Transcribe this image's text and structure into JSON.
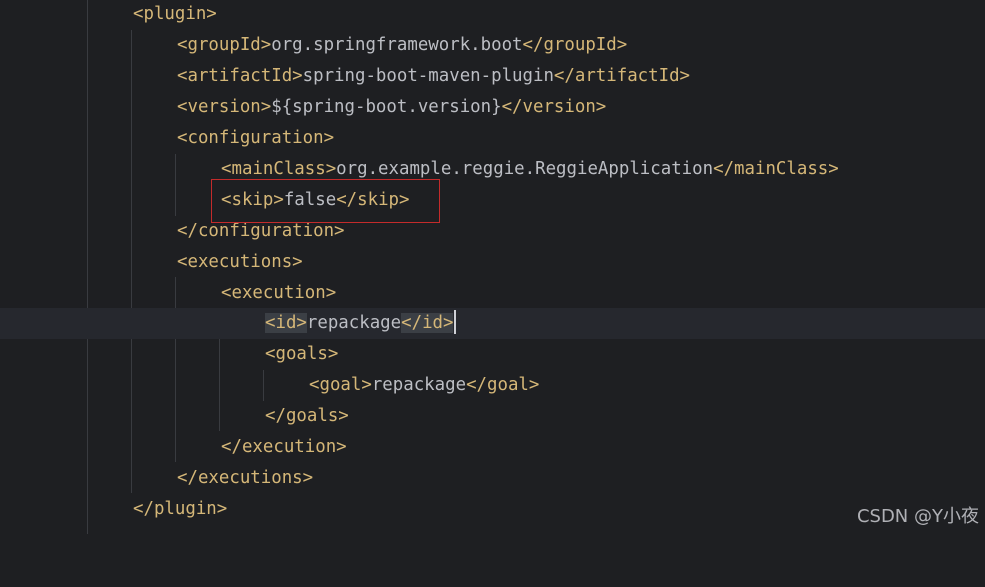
{
  "editor": {
    "lines": [
      {
        "open": "<plugin>",
        "text": "",
        "close": ""
      },
      {
        "open": "<groupId>",
        "text": "org.springframework.boot",
        "close": "</groupId>"
      },
      {
        "open": "<artifactId>",
        "text": "spring-boot-maven-plugin",
        "close": "</artifactId>"
      },
      {
        "open": "<version>",
        "text": "${spring-boot.version}",
        "close": "</version>"
      },
      {
        "open": "<configuration>",
        "text": "",
        "close": ""
      },
      {
        "open": "<mainClass>",
        "text": "org.example.reggie.ReggieApplication",
        "close": "</mainClass>"
      },
      {
        "open": "<skip>",
        "text": "false",
        "close": "</skip>"
      },
      {
        "open": "</configuration>",
        "text": "",
        "close": ""
      },
      {
        "open": "<executions>",
        "text": "",
        "close": ""
      },
      {
        "open": "<execution>",
        "text": "",
        "close": ""
      },
      {
        "open": "<id>",
        "text": "repackage",
        "close": "</id>"
      },
      {
        "open": "<goals>",
        "text": "",
        "close": ""
      },
      {
        "open": "<goal>",
        "text": "repackage",
        "close": "</goal>"
      },
      {
        "open": "</goals>",
        "text": "",
        "close": ""
      },
      {
        "open": "</execution>",
        "text": "",
        "close": ""
      },
      {
        "open": "</executions>",
        "text": "",
        "close": ""
      },
      {
        "open": "</plugin>",
        "text": "",
        "close": ""
      }
    ]
  },
  "watermark": "CSDN @Y小夜",
  "colors": {
    "background": "#1e1f22",
    "tag": "#d5b778",
    "text": "#bcbec4",
    "highlight_box": "#c42b2b"
  }
}
